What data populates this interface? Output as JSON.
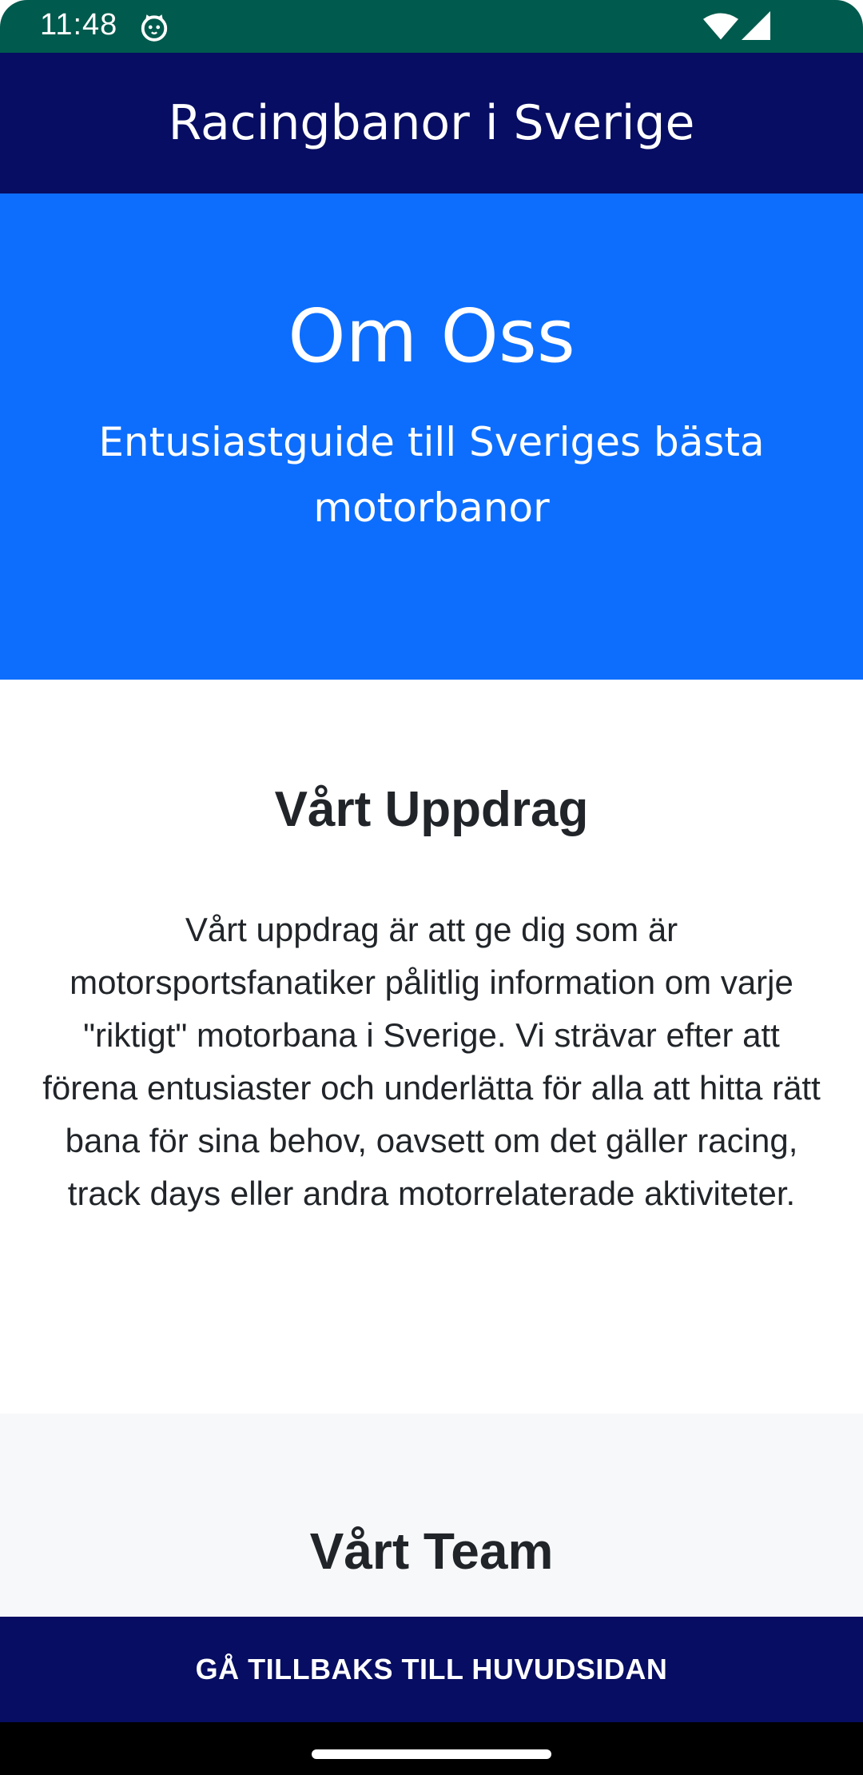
{
  "status_bar": {
    "time": "11:48",
    "icons": [
      "cat-notification-icon",
      "wifi-icon",
      "cell-signal-icon"
    ]
  },
  "app_bar": {
    "title": "Racingbanor i Sverige"
  },
  "hero": {
    "title": "Om Oss",
    "subtitle": "Entusiastguide till Sveriges bästa motorbanor"
  },
  "mission": {
    "title": "Vårt Uppdrag",
    "text": "Vårt uppdrag är att ge dig som är motorsportsfanatiker pålitlig information om varje \"riktigt\" motorbana i Sverige. Vi strävar efter att förena entusiaster och underlätta för alla att hitta rätt bana för sina behov, oavsett om det gäller racing, track days eller andra motorrelaterade aktiviteter."
  },
  "team": {
    "title": "Vårt Team"
  },
  "back_button": {
    "label": "GÅ TILLBAKS TILL HUVUDSIDAN"
  },
  "colors": {
    "status_bar": "#005a4d",
    "app_bar": "#070d62",
    "hero": "#0d6efd",
    "team_bg": "#f7f8fa",
    "text_dark": "#212529"
  }
}
